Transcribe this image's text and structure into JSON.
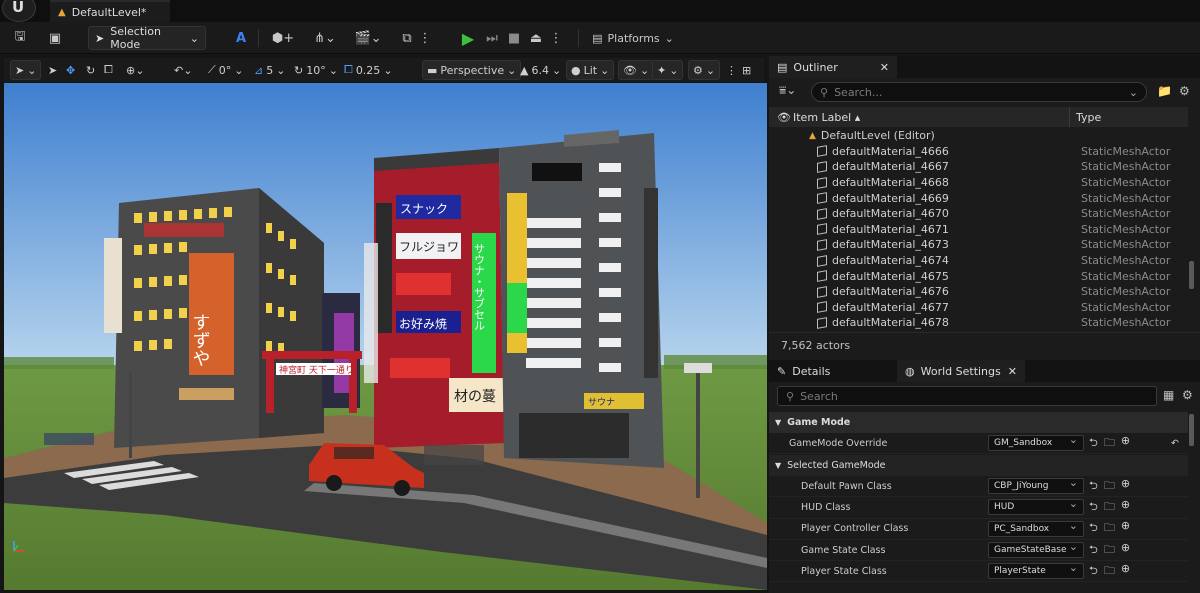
{
  "window": {
    "tab_title": "DefaultLevel*"
  },
  "toolbar": {
    "mode_label": "Selection Mode",
    "platforms_label": "Platforms"
  },
  "viewport_toolbar": {
    "rotate_snap": "0°",
    "grid_snap": "5",
    "angle_snap": "10°",
    "scale_snap": "0.25",
    "view_mode": "Perspective",
    "camera_speed": "6.4",
    "lit_label": "Lit"
  },
  "outliner": {
    "tab_label": "Outliner",
    "search_placeholder": "Search...",
    "col_label": "Item Label ▴",
    "col_type": "Type",
    "root_item": "DefaultLevel (Editor)",
    "items": [
      {
        "label": "defaultMaterial_4666",
        "type": "StaticMeshActor"
      },
      {
        "label": "defaultMaterial_4667",
        "type": "StaticMeshActor"
      },
      {
        "label": "defaultMaterial_4668",
        "type": "StaticMeshActor"
      },
      {
        "label": "defaultMaterial_4669",
        "type": "StaticMeshActor"
      },
      {
        "label": "defaultMaterial_4670",
        "type": "StaticMeshActor"
      },
      {
        "label": "defaultMaterial_4671",
        "type": "StaticMeshActor"
      },
      {
        "label": "defaultMaterial_4673",
        "type": "StaticMeshActor"
      },
      {
        "label": "defaultMaterial_4674",
        "type": "StaticMeshActor"
      },
      {
        "label": "defaultMaterial_4675",
        "type": "StaticMeshActor"
      },
      {
        "label": "defaultMaterial_4676",
        "type": "StaticMeshActor"
      },
      {
        "label": "defaultMaterial_4677",
        "type": "StaticMeshActor"
      },
      {
        "label": "defaultMaterial_4678",
        "type": "StaticMeshActor"
      }
    ],
    "actor_count": "7,562 actors"
  },
  "details": {
    "details_tab": "Details",
    "world_settings_tab": "World Settings",
    "search_placeholder": "Search",
    "game_mode_category": "Game Mode",
    "selected_gamemode_category": "Selected GameMode",
    "rows": [
      {
        "name": "GameMode Override",
        "value": "GM_Sandbox"
      },
      {
        "name": "Default Pawn Class",
        "value": "CBP_JiYoung"
      },
      {
        "name": "HUD Class",
        "value": "HUD"
      },
      {
        "name": "Player Controller Class",
        "value": "PC_Sandbox"
      },
      {
        "name": "Game State Class",
        "value": "GameStateBase"
      },
      {
        "name": "Player State Class",
        "value": "PlayerState"
      }
    ]
  },
  "scene_signs": {
    "snack": "スナック",
    "fulujyowa": "フルジョワ",
    "sauna": "サウナ・サブセル",
    "okonomiyaki": "お好み焼",
    "gate": "神宮町 天下一通り",
    "zai": "材の蔓",
    "suzuya": "すずや",
    "sauna2": "サウナ"
  },
  "colors": {
    "accent_play": "#3fbf3f",
    "sky_top": "#3f7fcf",
    "sky_bottom": "#b9d6ee",
    "grass": "#5f8a3a",
    "road": "#3c3c3c"
  }
}
